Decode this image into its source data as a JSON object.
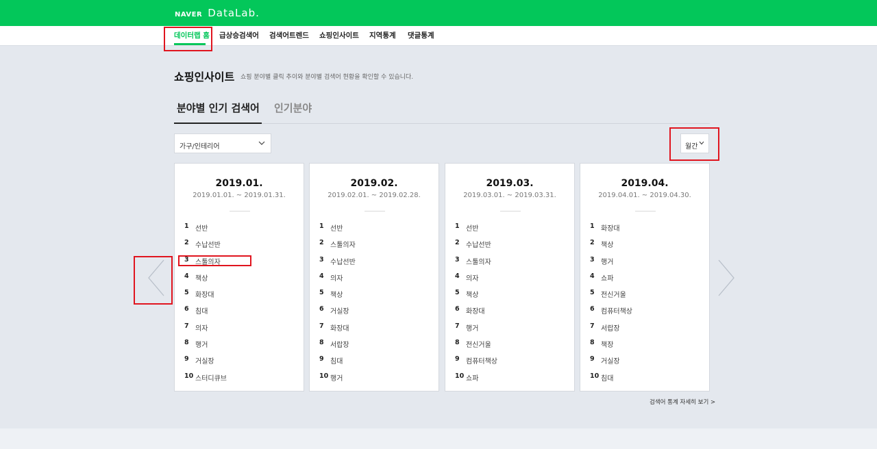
{
  "colors": {
    "brand_green": "#03c75a",
    "highlight_red": "#e0141e"
  },
  "header": {
    "naver": "NAVER",
    "datalab": "DataLab."
  },
  "nav": {
    "items": [
      {
        "label": "데이터랩 홈"
      },
      {
        "label": "급상승검색어"
      },
      {
        "label": "검색어트렌드"
      },
      {
        "label": "쇼핑인사이트"
      },
      {
        "label": "지역통계"
      },
      {
        "label": "댓글통계"
      }
    ]
  },
  "page": {
    "title": "쇼핑인사이트",
    "description": "쇼핑 분야별 클릭 추이와 분야별 검색어 현황을 확인할 수 있습니다."
  },
  "tabs": [
    {
      "label": "분야별 인기 검색어"
    },
    {
      "label": "인기분야"
    }
  ],
  "filters": {
    "category": "가구/인테리어",
    "period": "월간"
  },
  "cards": [
    {
      "month": "2019.01.",
      "range": "2019.01.01. ~ 2019.01.31.",
      "keywords": [
        "선반",
        "수납선반",
        "스툴의자",
        "책상",
        "화장대",
        "침대",
        "의자",
        "행거",
        "거실장",
        "스터디큐브"
      ]
    },
    {
      "month": "2019.02.",
      "range": "2019.02.01. ~ 2019.02.28.",
      "keywords": [
        "선반",
        "스툴의자",
        "수납선반",
        "의자",
        "책상",
        "거실장",
        "화장대",
        "서랍장",
        "침대",
        "행거"
      ]
    },
    {
      "month": "2019.03.",
      "range": "2019.03.01. ~ 2019.03.31.",
      "keywords": [
        "선반",
        "수납선반",
        "스툴의자",
        "의자",
        "책상",
        "화장대",
        "행거",
        "전신거울",
        "컴퓨터책상",
        "쇼파"
      ]
    },
    {
      "month": "2019.04.",
      "range": "2019.04.01. ~ 2019.04.30.",
      "keywords": [
        "화장대",
        "책상",
        "행거",
        "쇼파",
        "전신거울",
        "컴퓨터책상",
        "서랍장",
        "책장",
        "거실장",
        "침대"
      ]
    }
  ],
  "more_link": "검색어 통계 자세히 보기 >",
  "icons": {
    "prev": "chevron-left-icon",
    "next": "chevron-right-icon",
    "dropdown": "chevron-down-icon"
  }
}
